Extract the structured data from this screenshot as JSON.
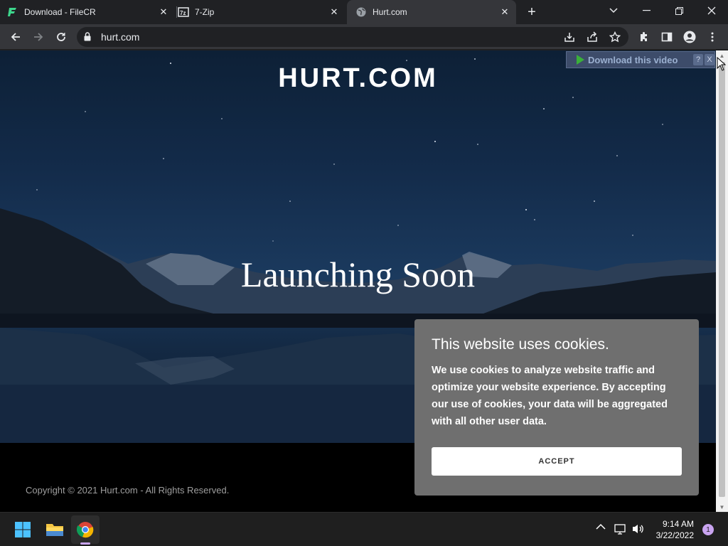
{
  "tabs": [
    {
      "title": "Download - FileCR",
      "favicon": "filecr-icon",
      "active": false
    },
    {
      "title": "7-Zip",
      "favicon": "7zip-icon",
      "active": false
    },
    {
      "title": "Hurt.com",
      "favicon": "globe-icon",
      "active": true
    }
  ],
  "tab_close": "✕",
  "new_tab": "+",
  "address_bar": {
    "url": "hurt.com"
  },
  "page": {
    "site_title": "HURT.COM",
    "headline": "Launching Soon",
    "copyright": "Copyright © 2021 Hurt.com - All Rights Reserved."
  },
  "video_extension": {
    "label": "Download this video",
    "help": "?",
    "close": "X"
  },
  "cookie_banner": {
    "title": "This website uses cookies.",
    "body": "We use cookies to analyze website traffic and optimize your website experience. By accepting our use of cookies, your data will be aggregated with all other user data.",
    "accept_label": "ACCEPT"
  },
  "taskbar": {
    "time": "9:14 AM",
    "date": "3/22/2022",
    "notification_count": "1"
  },
  "colors": {
    "chrome_dark": "#202124",
    "toolbar": "#35363a",
    "cookie_bg": "#6f6f6f",
    "accent_purple": "#c9a4f0"
  }
}
